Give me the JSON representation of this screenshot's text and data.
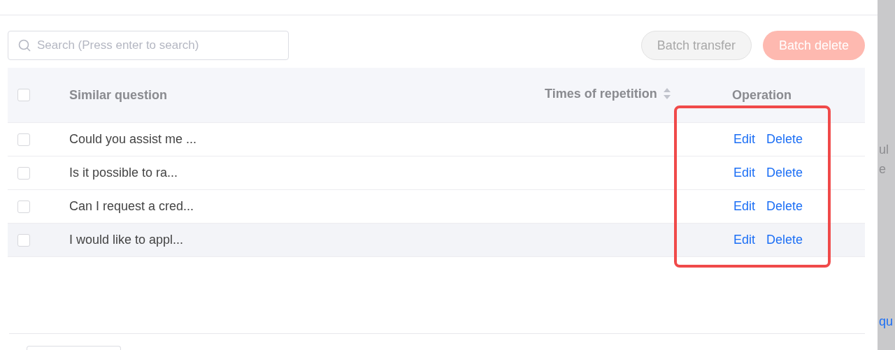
{
  "search": {
    "placeholder": "Search (Press enter to search)"
  },
  "buttons": [
    {
      "label": "Batch transfer",
      "kind": "default",
      "disabled": true
    },
    {
      "label": "Batch delete",
      "kind": "danger",
      "disabled": true
    }
  ],
  "table": {
    "select_all": {
      "checked": false
    },
    "columns": [
      {
        "label": "Similar question",
        "sortable": false
      },
      {
        "label": "Times of repetition",
        "sortable": true
      },
      {
        "label": "Operation",
        "sortable": false
      }
    ],
    "rows": [
      {
        "checked": false,
        "hovered": false,
        "question": "Could you assist me ...",
        "times": "",
        "actions": [
          "Edit",
          "Delete"
        ]
      },
      {
        "checked": false,
        "hovered": false,
        "question": "Is it possible to ra...",
        "times": "",
        "actions": [
          "Edit",
          "Delete"
        ]
      },
      {
        "checked": false,
        "hovered": false,
        "question": "Can I request a cred...",
        "times": "",
        "actions": [
          "Edit",
          "Delete"
        ]
      },
      {
        "checked": false,
        "hovered": true,
        "question": "I would like to appl...",
        "times": "",
        "actions": [
          "Edit",
          "Delete"
        ]
      }
    ]
  },
  "annotation": {
    "kind": "outline",
    "color": "#f04a4a"
  },
  "backdrop": {
    "fragments": [
      {
        "text": "ul",
        "kind": "plain"
      },
      {
        "text": "e",
        "kind": "plain"
      },
      {
        "text": "qu",
        "kind": "link"
      }
    ]
  }
}
